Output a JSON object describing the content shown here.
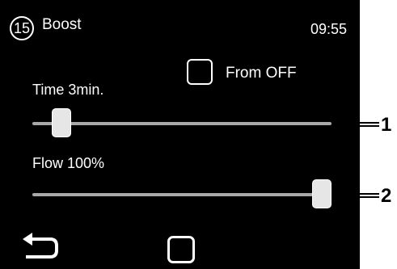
{
  "header": {
    "menu_number": "15",
    "title": "Boost",
    "time": "09:55"
  },
  "options": {
    "from_off_label": "From OFF",
    "from_off_checked": false
  },
  "sliders": {
    "time": {
      "label": "Time 3min.",
      "level": 0.07
    },
    "flow": {
      "label": "Flow 100%",
      "level": 1.0
    }
  },
  "navigation": {
    "back_icon": "back-arrow-icon",
    "home_icon": "square-home-icon"
  },
  "callouts": {
    "one": "1",
    "two": "2"
  }
}
